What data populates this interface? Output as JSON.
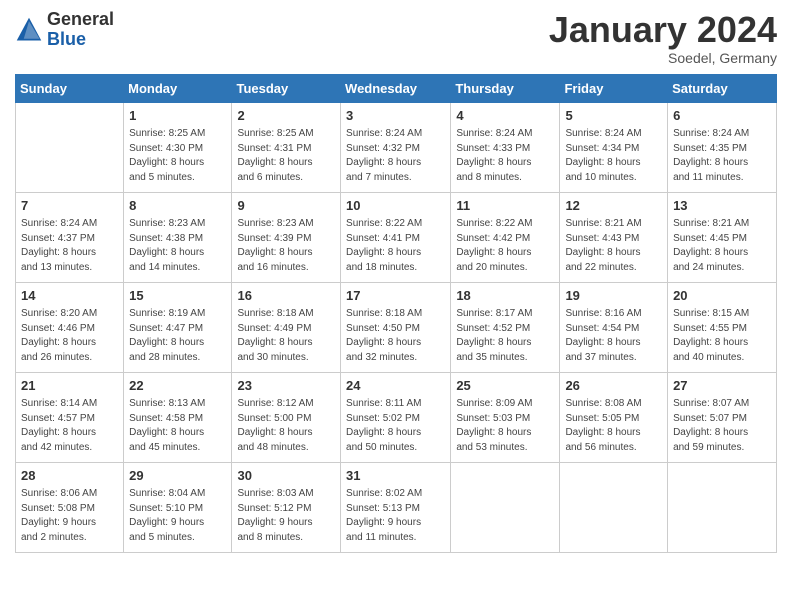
{
  "header": {
    "logo_general": "General",
    "logo_blue": "Blue",
    "month_year": "January 2024",
    "location": "Soedel, Germany"
  },
  "days_of_week": [
    "Sunday",
    "Monday",
    "Tuesday",
    "Wednesday",
    "Thursday",
    "Friday",
    "Saturday"
  ],
  "weeks": [
    [
      {
        "day": "",
        "info": ""
      },
      {
        "day": "1",
        "info": "Sunrise: 8:25 AM\nSunset: 4:30 PM\nDaylight: 8 hours\nand 5 minutes."
      },
      {
        "day": "2",
        "info": "Sunrise: 8:25 AM\nSunset: 4:31 PM\nDaylight: 8 hours\nand 6 minutes."
      },
      {
        "day": "3",
        "info": "Sunrise: 8:24 AM\nSunset: 4:32 PM\nDaylight: 8 hours\nand 7 minutes."
      },
      {
        "day": "4",
        "info": "Sunrise: 8:24 AM\nSunset: 4:33 PM\nDaylight: 8 hours\nand 8 minutes."
      },
      {
        "day": "5",
        "info": "Sunrise: 8:24 AM\nSunset: 4:34 PM\nDaylight: 8 hours\nand 10 minutes."
      },
      {
        "day": "6",
        "info": "Sunrise: 8:24 AM\nSunset: 4:35 PM\nDaylight: 8 hours\nand 11 minutes."
      }
    ],
    [
      {
        "day": "7",
        "info": "Sunrise: 8:24 AM\nSunset: 4:37 PM\nDaylight: 8 hours\nand 13 minutes."
      },
      {
        "day": "8",
        "info": "Sunrise: 8:23 AM\nSunset: 4:38 PM\nDaylight: 8 hours\nand 14 minutes."
      },
      {
        "day": "9",
        "info": "Sunrise: 8:23 AM\nSunset: 4:39 PM\nDaylight: 8 hours\nand 16 minutes."
      },
      {
        "day": "10",
        "info": "Sunrise: 8:22 AM\nSunset: 4:41 PM\nDaylight: 8 hours\nand 18 minutes."
      },
      {
        "day": "11",
        "info": "Sunrise: 8:22 AM\nSunset: 4:42 PM\nDaylight: 8 hours\nand 20 minutes."
      },
      {
        "day": "12",
        "info": "Sunrise: 8:21 AM\nSunset: 4:43 PM\nDaylight: 8 hours\nand 22 minutes."
      },
      {
        "day": "13",
        "info": "Sunrise: 8:21 AM\nSunset: 4:45 PM\nDaylight: 8 hours\nand 24 minutes."
      }
    ],
    [
      {
        "day": "14",
        "info": "Sunrise: 8:20 AM\nSunset: 4:46 PM\nDaylight: 8 hours\nand 26 minutes."
      },
      {
        "day": "15",
        "info": "Sunrise: 8:19 AM\nSunset: 4:47 PM\nDaylight: 8 hours\nand 28 minutes."
      },
      {
        "day": "16",
        "info": "Sunrise: 8:18 AM\nSunset: 4:49 PM\nDaylight: 8 hours\nand 30 minutes."
      },
      {
        "day": "17",
        "info": "Sunrise: 8:18 AM\nSunset: 4:50 PM\nDaylight: 8 hours\nand 32 minutes."
      },
      {
        "day": "18",
        "info": "Sunrise: 8:17 AM\nSunset: 4:52 PM\nDaylight: 8 hours\nand 35 minutes."
      },
      {
        "day": "19",
        "info": "Sunrise: 8:16 AM\nSunset: 4:54 PM\nDaylight: 8 hours\nand 37 minutes."
      },
      {
        "day": "20",
        "info": "Sunrise: 8:15 AM\nSunset: 4:55 PM\nDaylight: 8 hours\nand 40 minutes."
      }
    ],
    [
      {
        "day": "21",
        "info": "Sunrise: 8:14 AM\nSunset: 4:57 PM\nDaylight: 8 hours\nand 42 minutes."
      },
      {
        "day": "22",
        "info": "Sunrise: 8:13 AM\nSunset: 4:58 PM\nDaylight: 8 hours\nand 45 minutes."
      },
      {
        "day": "23",
        "info": "Sunrise: 8:12 AM\nSunset: 5:00 PM\nDaylight: 8 hours\nand 48 minutes."
      },
      {
        "day": "24",
        "info": "Sunrise: 8:11 AM\nSunset: 5:02 PM\nDaylight: 8 hours\nand 50 minutes."
      },
      {
        "day": "25",
        "info": "Sunrise: 8:09 AM\nSunset: 5:03 PM\nDaylight: 8 hours\nand 53 minutes."
      },
      {
        "day": "26",
        "info": "Sunrise: 8:08 AM\nSunset: 5:05 PM\nDaylight: 8 hours\nand 56 minutes."
      },
      {
        "day": "27",
        "info": "Sunrise: 8:07 AM\nSunset: 5:07 PM\nDaylight: 8 hours\nand 59 minutes."
      }
    ],
    [
      {
        "day": "28",
        "info": "Sunrise: 8:06 AM\nSunset: 5:08 PM\nDaylight: 9 hours\nand 2 minutes."
      },
      {
        "day": "29",
        "info": "Sunrise: 8:04 AM\nSunset: 5:10 PM\nDaylight: 9 hours\nand 5 minutes."
      },
      {
        "day": "30",
        "info": "Sunrise: 8:03 AM\nSunset: 5:12 PM\nDaylight: 9 hours\nand 8 minutes."
      },
      {
        "day": "31",
        "info": "Sunrise: 8:02 AM\nSunset: 5:13 PM\nDaylight: 9 hours\nand 11 minutes."
      },
      {
        "day": "",
        "info": ""
      },
      {
        "day": "",
        "info": ""
      },
      {
        "day": "",
        "info": ""
      }
    ]
  ]
}
